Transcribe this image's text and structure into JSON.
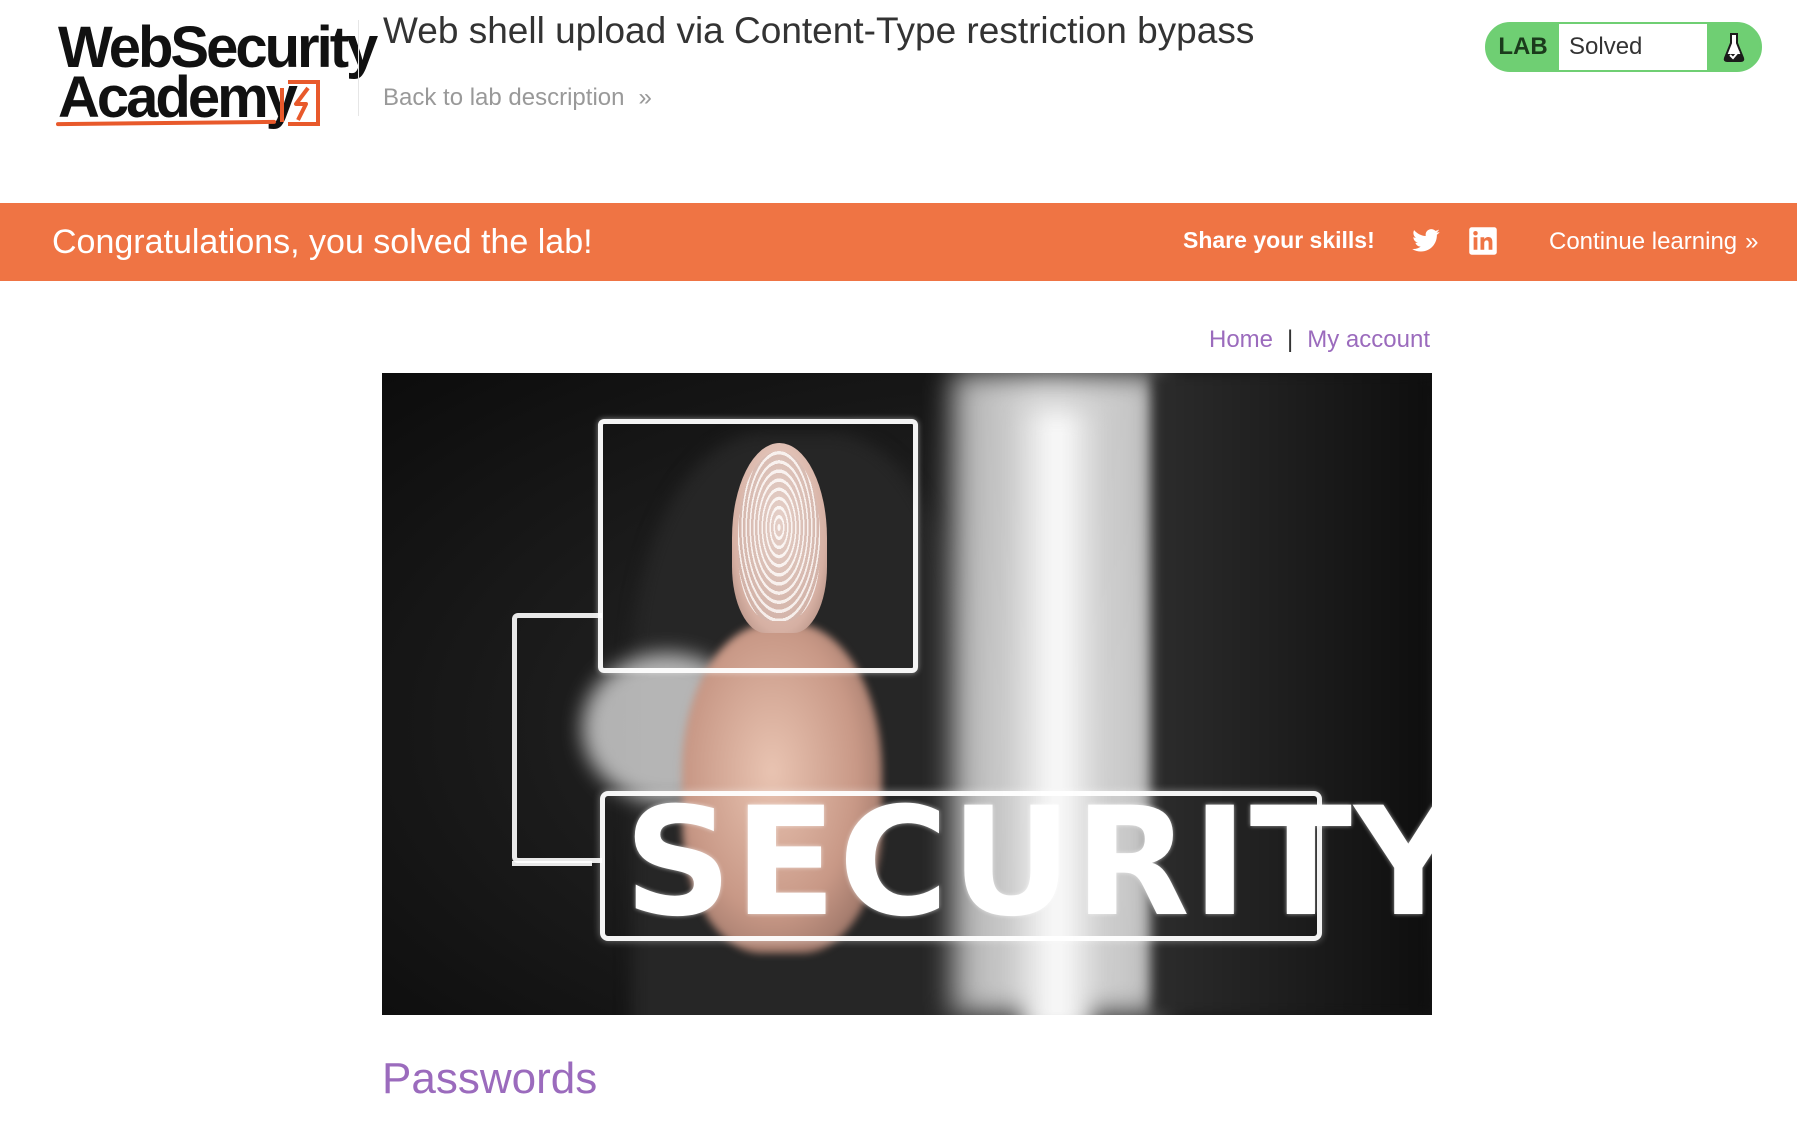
{
  "logo": {
    "line1": "WebSecurity",
    "line2": "Academy"
  },
  "header": {
    "lab_title": "Web shell upload via Content-Type restriction bypass",
    "back_link": "Back to lab description",
    "back_chevron": "»"
  },
  "lab_status": {
    "badge": "LAB",
    "state": "Solved",
    "icon": "flask-icon",
    "color": "#6fcf73"
  },
  "banner": {
    "message": "Congratulations, you solved the lab!",
    "share_label": "Share your skills!",
    "continue_label": "Continue learning",
    "continue_chevron": "»",
    "color": "#ef7444"
  },
  "nav": {
    "home": "Home",
    "separator": "|",
    "my_account": "My account",
    "link_color": "#9b6bbd"
  },
  "hero": {
    "overlay_text": "SECURITY"
  },
  "post": {
    "title": "Passwords"
  }
}
